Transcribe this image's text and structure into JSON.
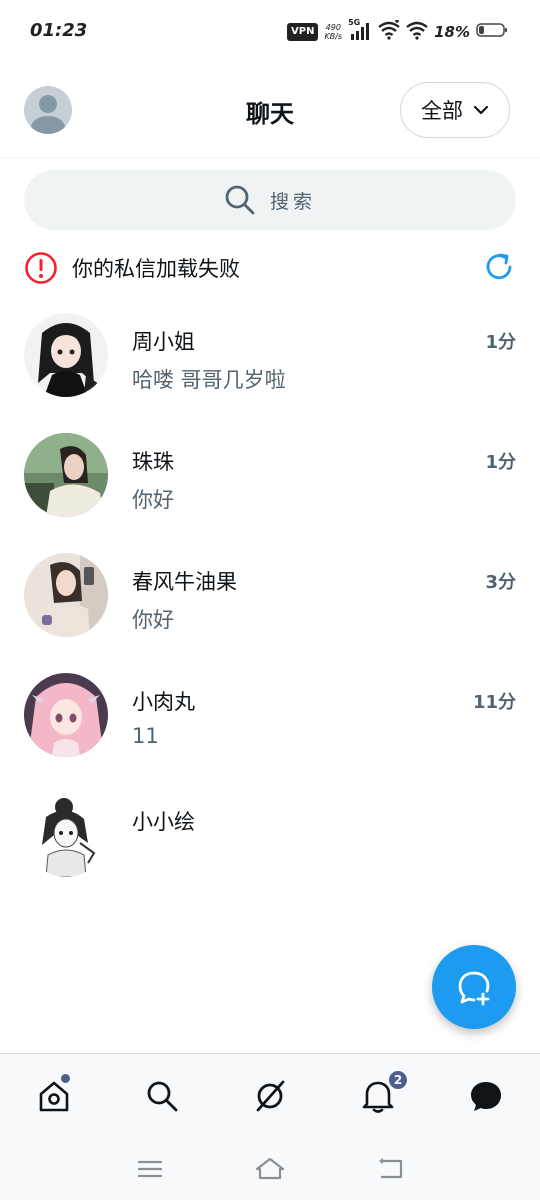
{
  "status_bar": {
    "time": "01:23",
    "vpn": "VPN",
    "net_speed_value": "490",
    "net_speed_unit": "KB/s",
    "signal_type": "5G",
    "battery": "18%"
  },
  "header": {
    "title": "聊天",
    "filter_label": "全部"
  },
  "search": {
    "placeholder": "搜索"
  },
  "error_banner": {
    "text": "你的私信加载失败"
  },
  "chats": [
    {
      "name": "周小姐",
      "message": "哈喽  哥哥几岁啦",
      "time": "1分"
    },
    {
      "name": "珠珠",
      "message": "你好",
      "time": "1分"
    },
    {
      "name": "春风牛油果",
      "message": "你好",
      "time": "3分"
    },
    {
      "name": "小肉丸",
      "message": "11",
      "time": "11分"
    },
    {
      "name": "小小绘",
      "message": "",
      "time": ""
    }
  ],
  "bottom_nav": {
    "notifications_badge": "2"
  },
  "colors": {
    "accent": "#1d9bf0",
    "error": "#f4212e",
    "badge": "#4e5f8e"
  }
}
